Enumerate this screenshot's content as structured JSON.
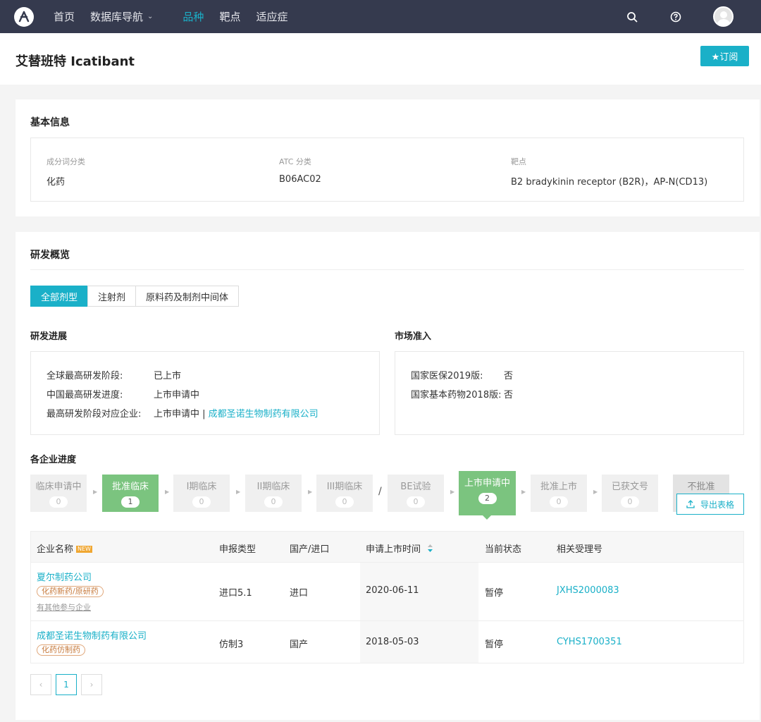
{
  "nav": {
    "items": [
      {
        "label": "首页",
        "active": false
      },
      {
        "label": "数据库导航",
        "active": false,
        "dropdown": true
      },
      {
        "label": "品种",
        "active": true
      },
      {
        "label": "靶点",
        "active": false
      },
      {
        "label": "适应症",
        "active": false
      }
    ]
  },
  "header": {
    "title": "艾替班特 Icatibant",
    "subscribe_label": "★订阅"
  },
  "basic_info": {
    "title": "基本信息",
    "fields": [
      {
        "label": "成分词分类",
        "value": "化药"
      },
      {
        "label": "ATC 分类",
        "value": "B06AC02"
      },
      {
        "label": "靶点",
        "value": "B2 bradykinin receptor (B2R)，AP-N(CD13)"
      }
    ]
  },
  "dev": {
    "title": "研发概览",
    "tabs": [
      {
        "label": "全部剂型",
        "active": true
      },
      {
        "label": "注射剂",
        "active": false
      },
      {
        "label": "原料药及制剂中间体",
        "active": false
      }
    ],
    "progress": {
      "title": "研发进展",
      "rows": [
        {
          "label": "全球最高研发阶段:",
          "value": "已上市"
        },
        {
          "label": "中国最高研发进度:",
          "value": "上市申请中"
        },
        {
          "label": "最高研发阶段对应企业:",
          "value": "上市申请中 | ",
          "link": "成都圣诺生物制药有限公司"
        }
      ]
    },
    "market": {
      "title": "市场准入",
      "rows": [
        {
          "label": "国家医保2019版:",
          "value": "否"
        },
        {
          "label": "国家基本药物2018版:",
          "value": "否"
        }
      ]
    },
    "company_progress": {
      "title": "各企业进度",
      "stages": [
        {
          "label": "临床申请中",
          "count": "0",
          "state": "normal"
        },
        {
          "label": "批准临床",
          "count": "1",
          "state": "green"
        },
        {
          "label": "I期临床",
          "count": "0",
          "state": "normal"
        },
        {
          "label": "II期临床",
          "count": "0",
          "state": "normal"
        },
        {
          "label": "III期临床",
          "count": "0",
          "state": "normal"
        },
        {
          "label": "BE试验",
          "count": "0",
          "state": "normal"
        },
        {
          "label": "上市申请中",
          "count": "2",
          "state": "selected"
        },
        {
          "label": "批准上市",
          "count": "0",
          "state": "normal"
        },
        {
          "label": "已获文号",
          "count": "0",
          "state": "normal"
        },
        {
          "label": "不批准",
          "count": "",
          "state": "gray"
        }
      ],
      "slash": "/",
      "export_label": "导出表格"
    },
    "table": {
      "headers": {
        "company": "企业名称",
        "new_badge": "NEW",
        "type": "申报类型",
        "origin": "国产/进口",
        "date": "申请上市时间",
        "status": "当前状态",
        "accept": "相关受理号"
      },
      "rows": [
        {
          "company": "夏尔制药公司",
          "tag": "化药新药/原研药",
          "note": "有其他参与企业",
          "type": "进口5.1",
          "origin": "进口",
          "date": "2020-06-11",
          "status": "暂停",
          "accept": "JXHS2000083"
        },
        {
          "company": "成都圣诺生物制药有限公司",
          "tag": "化药仿制药",
          "note": "",
          "type": "仿制3",
          "origin": "国产",
          "date": "2018-05-03",
          "status": "暂停",
          "accept": "CYHS1700351"
        }
      ]
    },
    "pagination": {
      "prev": "‹",
      "current": "1",
      "next": "›"
    }
  },
  "colors": {
    "accent": "#1ab0c8",
    "nav_bg": "#353a4e",
    "stage_green": "#7bc47f"
  }
}
